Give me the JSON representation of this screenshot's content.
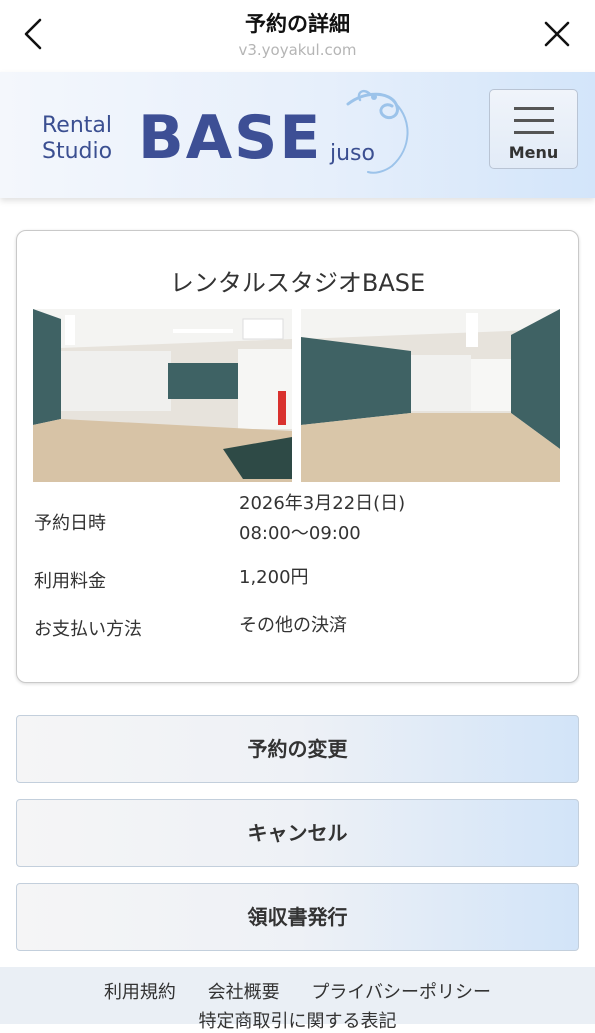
{
  "browser": {
    "title": "予約の詳細",
    "url": "v3.yoyakul.com",
    "back_icon": "chevron-left-icon",
    "close_icon": "close-icon"
  },
  "header": {
    "logo": {
      "rental": "Rental",
      "studio": "Studio",
      "base": "BASE",
      "juso": "juso"
    },
    "menu_label": "Menu",
    "brand_color": "#3d4f95"
  },
  "reservation": {
    "studio_name": "レンタルスタジオBASE",
    "fields": [
      {
        "label": "予約日時",
        "value_line1": "2026年3月22日(日)",
        "value_line2": "08:00〜09:00"
      },
      {
        "label": "利用料金",
        "value_line1": "1,200円"
      },
      {
        "label": "お支払い方法",
        "value_line1": "その他の決済"
      }
    ]
  },
  "actions": {
    "change": "予約の変更",
    "cancel": "キャンセル",
    "receipt": "領収書発行"
  },
  "footer": {
    "links": [
      "利用規約",
      "会社概要",
      "プライバシーポリシー"
    ],
    "links2": "特定商取引に関する表記"
  }
}
